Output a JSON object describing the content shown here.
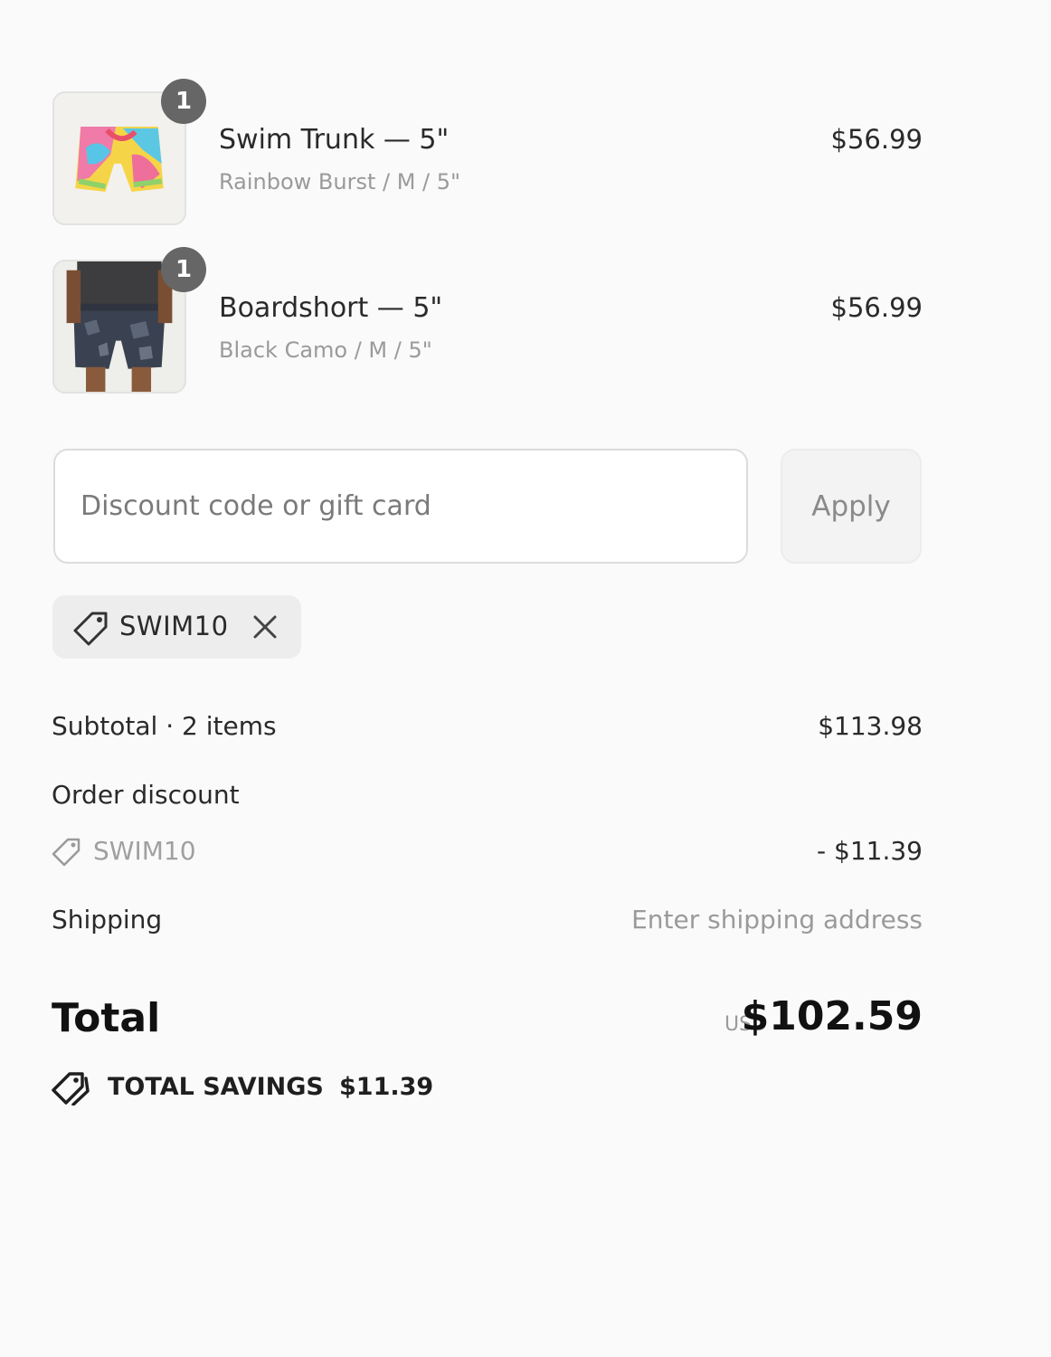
{
  "line_items": [
    {
      "quantity": "1",
      "title": "Swim Trunk — 5\"",
      "variant": "Rainbow Burst / M / 5\"",
      "price": "$56.99",
      "image_icon": "rainbow-shorts-image"
    },
    {
      "quantity": "1",
      "title": "Boardshort — 5\"",
      "variant": "Black Camo / M / 5\"",
      "price": "$56.99",
      "image_icon": "camo-shorts-image"
    }
  ],
  "discount": {
    "placeholder": "Discount code or gift card",
    "apply_label": "Apply",
    "applied_code": "SWIM10"
  },
  "summary": {
    "subtotal_label": "Subtotal · 2 items",
    "subtotal_value": "$113.98",
    "order_discount_label": "Order discount",
    "discount_code": "SWIM10",
    "discount_value": "- $11.39",
    "shipping_label": "Shipping",
    "shipping_value": "Enter shipping address",
    "total_label": "Total",
    "currency": "USD",
    "total_value": "$102.59",
    "savings_label": "TOTAL SAVINGS",
    "savings_value": "$11.39"
  },
  "colors": {
    "background": "#fafafa",
    "badge": "#666666",
    "muted_text": "#9a9a9a",
    "chip_bg": "#ededed"
  }
}
